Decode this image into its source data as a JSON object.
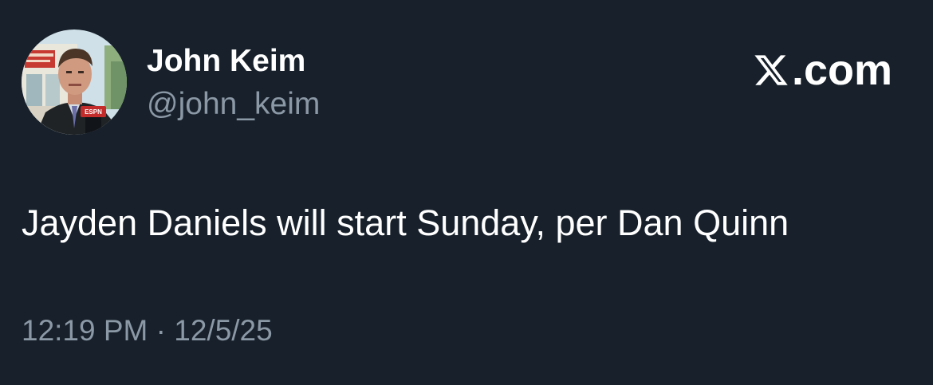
{
  "author": {
    "display_name": "John Keim",
    "handle": "@john_keim",
    "avatar_icon": "profile-photo",
    "mic_flag_text": "ESPN"
  },
  "brand": {
    "icon": "x-logo",
    "suffix": ".com"
  },
  "tweet": {
    "text": "Jayden Daniels will start Sunday, per Dan Quinn"
  },
  "meta": {
    "time": "12:19 PM",
    "separator": "·",
    "date": "12/5/25"
  },
  "colors": {
    "background": "#17202b",
    "primary_text": "#ffffff",
    "secondary_text": "#8b98a5"
  }
}
